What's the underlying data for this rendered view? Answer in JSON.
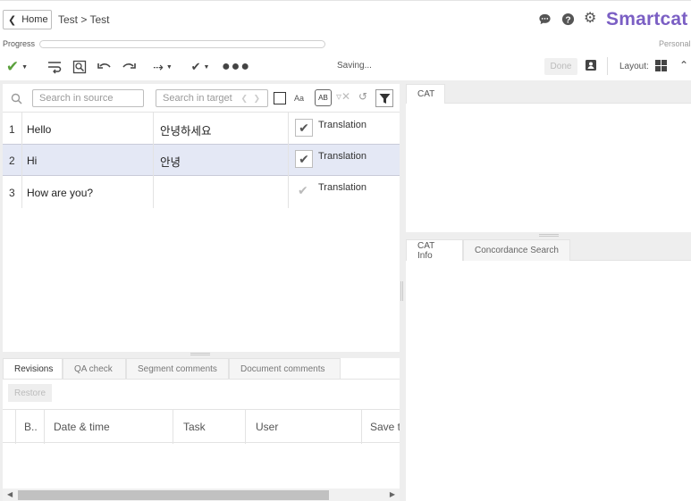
{
  "header": {
    "home_label": "Home",
    "breadcrumb": "Test > Test",
    "brand": "Smartcat",
    "plan": "Personal",
    "progress_label": "Progress"
  },
  "toolbar": {
    "saving_text": "Saving...",
    "done_label": "Done",
    "layout_label": "Layout:"
  },
  "editor": {
    "search_source_placeholder": "Search in source",
    "search_target_placeholder": "Search in target",
    "case_label": "Aa",
    "segments": [
      {
        "num": "1",
        "source": "Hello",
        "target": "안녕하세요",
        "status": "Translation"
      },
      {
        "num": "2",
        "source": "Hi",
        "target": "안녕",
        "status": "Translation"
      },
      {
        "num": "3",
        "source": "How are you?",
        "target": "",
        "status": "Translation"
      }
    ]
  },
  "bottom": {
    "tabs": [
      "Revisions",
      "QA check",
      "Segment comments",
      "Document comments"
    ],
    "restore_label": "Restore",
    "columns": [
      "B..",
      "Date & time",
      "Task",
      "User",
      "Save t"
    ]
  },
  "right": {
    "cat_tab": "CAT",
    "info_tabs": [
      "CAT Info",
      "Concordance Search"
    ]
  },
  "colors": {
    "brand": "#7b5fc4",
    "check_green": "#5aa03c",
    "selected_row": "#e4e8f5"
  }
}
